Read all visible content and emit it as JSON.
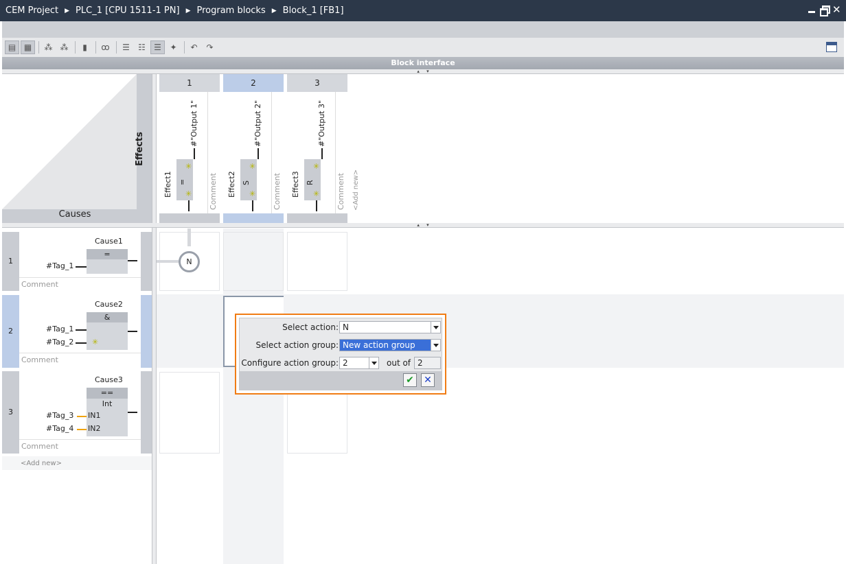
{
  "titlebar": {
    "breadcrumbs": [
      "CEM Project",
      "PLC_1 [CPU 1511-1 PN]",
      "Program blocks",
      "Block_1 [FB1]"
    ],
    "separator": "▶"
  },
  "block_interface": {
    "label": "Block interface"
  },
  "header": {
    "causes_label": "Causes",
    "effects_label": "Effects",
    "add_new_effect": "<Add new>"
  },
  "effects": [
    {
      "num": "1",
      "name": "Effect1",
      "op": "=",
      "output": "#\"Output 1\"",
      "comment": "Comment",
      "selected": false
    },
    {
      "num": "2",
      "name": "Effect2",
      "op": "S",
      "output": "#\"Output 2\"",
      "comment": "Comment",
      "selected": true
    },
    {
      "num": "3",
      "name": "Effect3",
      "op": "R",
      "output": "#\"Output 3\"",
      "comment": "Comment",
      "selected": false
    }
  ],
  "causes": [
    {
      "num": "1",
      "name": "Cause1",
      "op": "=",
      "inputs": [
        "#Tag_1"
      ],
      "comment": "Comment",
      "selected": false
    },
    {
      "num": "2",
      "name": "Cause2",
      "op": "&",
      "inputs": [
        "#Tag_1",
        "#Tag_2"
      ],
      "comment": "Comment",
      "selected": true
    },
    {
      "num": "3",
      "name": "Cause3",
      "op": "==",
      "subtype": "Int",
      "inputs": [
        "#Tag_3",
        "#Tag_4"
      ],
      "pins": [
        "IN1",
        "IN2"
      ],
      "comment": "Comment",
      "selected": false
    }
  ],
  "add_new_cause": "<Add new>",
  "intersection": {
    "row": 1,
    "col": 1,
    "action": "N"
  },
  "dialog": {
    "select_action_label": "Select action:",
    "select_action_value": "N",
    "select_group_label": "Select action group:",
    "select_group_value": "New action group",
    "configure_group_label": "Configure action group:",
    "configure_group_value": "2",
    "out_of_label": "out of",
    "out_of_value": "2",
    "ok_icon": "check-icon",
    "cancel_icon": "x-icon"
  },
  "colors": {
    "titlebar": "#2c3849",
    "selection": "#bccde8",
    "dialog_border": "#f07c14",
    "highlight": "#3a6fd8"
  }
}
